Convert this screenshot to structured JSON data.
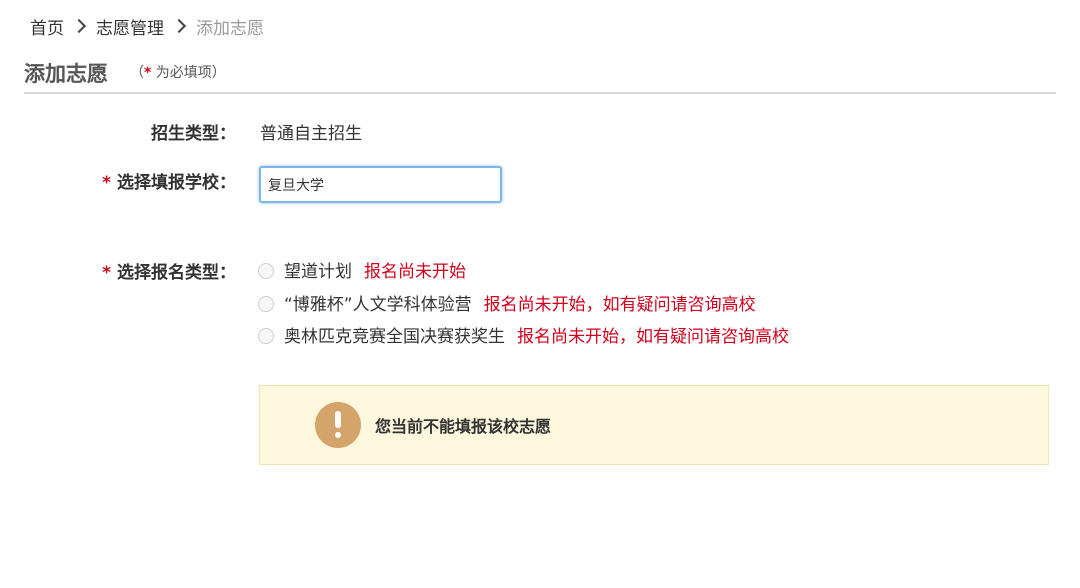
{
  "breadcrumb": {
    "items": [
      "首页",
      "志愿管理",
      "添加志愿"
    ]
  },
  "header": {
    "title": "添加志愿",
    "required_note_open": "（",
    "required_note_star": "*",
    "required_note_text": " 为必填项）"
  },
  "form": {
    "admission_type": {
      "label": "招生类型：",
      "value": "普通自主招生"
    },
    "school": {
      "star": "*",
      "label": "选择填报学校：",
      "value": "复旦大学"
    },
    "apply_type": {
      "star": "*",
      "label": "选择报名类型：",
      "options": [
        {
          "label": "望道计划",
          "status": "报名尚未开始"
        },
        {
          "label": "“博雅杯”人文学科体验营",
          "status": "报名尚未开始，如有疑问请咨询高校"
        },
        {
          "label": "奥林匹克竞赛全国决赛获奖生",
          "status": "报名尚未开始，如有疑问请咨询高校"
        }
      ]
    }
  },
  "warning": {
    "icon": "exclamation-icon",
    "text": "您当前不能填报该校志愿"
  },
  "colors": {
    "required": "#d0021b",
    "warning_bg": "#fcf7dd",
    "warning_icon": "#d4a46a",
    "input_focus": "#7eb6e8"
  }
}
